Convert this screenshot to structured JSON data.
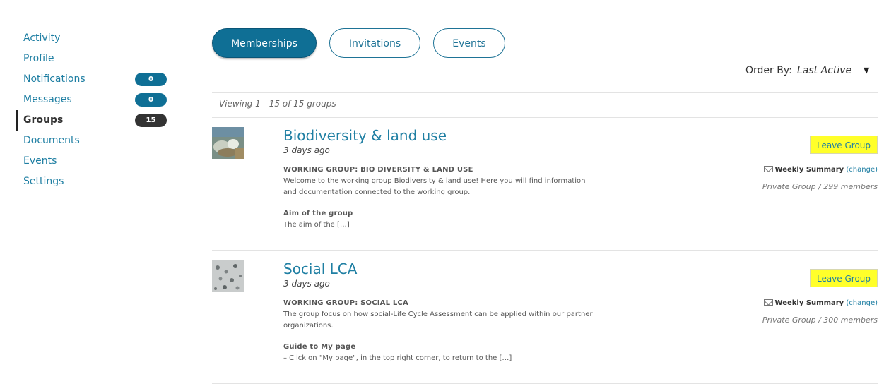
{
  "sidebar": {
    "items": [
      {
        "label": "Activity"
      },
      {
        "label": "Profile"
      },
      {
        "label": "Notifications",
        "count": "0"
      },
      {
        "label": "Messages",
        "count": "0"
      },
      {
        "label": "Groups",
        "count": "15"
      },
      {
        "label": "Documents"
      },
      {
        "label": "Events"
      },
      {
        "label": "Settings"
      }
    ]
  },
  "tabs": [
    "Memberships",
    "Invitations",
    "Events"
  ],
  "order_by": {
    "label": "Order By:",
    "value": "Last Active",
    "arrow": "▼"
  },
  "viewing": "Viewing 1 - 15 of 15 groups",
  "groups": [
    {
      "title": "Biodiversity & land use",
      "time": "3 days ago",
      "heading": "WORKING GROUP: BIO DIVERSITY & LAND USE",
      "description": "Welcome to the working group Biodiversity & land use! Here you will find information and documentation connected to the working group.",
      "subheading": "Aim of the group",
      "subtext": "The aim of the […]",
      "button": "Leave Group",
      "summary": "Weekly Summary",
      "change": "(change)",
      "status": "Private Group / 299 members"
    },
    {
      "title": "Social LCA",
      "time": "3 days ago",
      "heading": "WORKING GROUP: SOCIAL LCA",
      "description": "The group focus on how social-Life Cycle Assessment can be applied within our partner organizations.",
      "subheading": "Guide to My page",
      "subtext": "– Click on \"My page\", in the top right corner, to return to the […]",
      "button": "Leave Group",
      "summary": "Weekly Summary",
      "change": "(change)",
      "status": "Private Group / 300 members"
    }
  ],
  "colors": {
    "accent": "#0f6f95",
    "link": "#1f7fa3",
    "highlight": "#ffff2a"
  }
}
